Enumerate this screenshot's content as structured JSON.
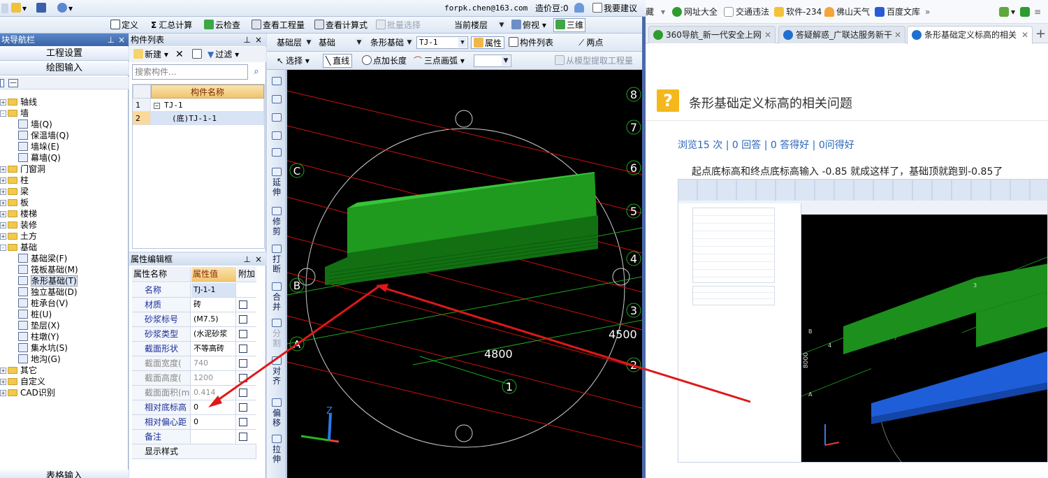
{
  "toolbar_top": {
    "email": "forpk.chen@163.com",
    "beans": "造价豆:0",
    "suggest": "我要建议"
  },
  "toolbar_main": {
    "define": "定义",
    "sum_calc": "汇总计算",
    "cloud_check": "云检查",
    "view_qty": "查看工程量",
    "view_formula": "查看计算式",
    "batch_select": "批量选择",
    "floor_select": "当前楼层",
    "top_view": "俯视",
    "three_d": "三维"
  },
  "nav": {
    "title": "块导航栏",
    "project_settings": "工程设置",
    "drawing_input": "绘图输入",
    "tree": [
      {
        "label": "轴线",
        "level": 0,
        "type": "folder",
        "expander": "+"
      },
      {
        "label": "墙",
        "level": 0,
        "type": "folder",
        "expander": "-"
      },
      {
        "label": "墙(Q)",
        "level": 1,
        "type": "leaf"
      },
      {
        "label": "保温墙(Q)",
        "level": 1,
        "type": "leaf"
      },
      {
        "label": "墙垛(E)",
        "level": 1,
        "type": "leaf"
      },
      {
        "label": "幕墙(Q)",
        "level": 1,
        "type": "leaf"
      },
      {
        "label": "门窗洞",
        "level": 0,
        "type": "folder",
        "expander": "+"
      },
      {
        "label": "柱",
        "level": 0,
        "type": "folder",
        "expander": "+"
      },
      {
        "label": "梁",
        "level": 0,
        "type": "folder",
        "expander": "+"
      },
      {
        "label": "板",
        "level": 0,
        "type": "folder",
        "expander": "+"
      },
      {
        "label": "楼梯",
        "level": 0,
        "type": "folder",
        "expander": "+"
      },
      {
        "label": "装修",
        "level": 0,
        "type": "folder",
        "expander": "+"
      },
      {
        "label": "土方",
        "level": 0,
        "type": "folder",
        "expander": "+"
      },
      {
        "label": "基础",
        "level": 0,
        "type": "folder",
        "expander": "-"
      },
      {
        "label": "基础梁(F)",
        "level": 1,
        "type": "leaf"
      },
      {
        "label": "筏板基础(M)",
        "level": 1,
        "type": "leaf"
      },
      {
        "label": "条形基础(T)",
        "level": 1,
        "type": "leaf",
        "selected": true
      },
      {
        "label": "独立基础(D)",
        "level": 1,
        "type": "leaf"
      },
      {
        "label": "桩承台(V)",
        "level": 1,
        "type": "leaf"
      },
      {
        "label": "桩(U)",
        "level": 1,
        "type": "leaf"
      },
      {
        "label": "垫层(X)",
        "level": 1,
        "type": "leaf"
      },
      {
        "label": "柱墩(Y)",
        "level": 1,
        "type": "leaf"
      },
      {
        "label": "集水坑(S)",
        "level": 1,
        "type": "leaf"
      },
      {
        "label": "地沟(G)",
        "level": 1,
        "type": "leaf"
      },
      {
        "label": "其它",
        "level": 0,
        "type": "folder",
        "expander": "+"
      },
      {
        "label": "自定义",
        "level": 0,
        "type": "folder",
        "expander": "+"
      },
      {
        "label": "CAD识别",
        "level": 0,
        "type": "folder",
        "expander": "+"
      }
    ],
    "bottom_button": "表格输入"
  },
  "component_list": {
    "title": "构件列表",
    "new_label": "新建",
    "filter_label": "过滤",
    "search_placeholder": "搜索构件...",
    "col_header": "构件名称",
    "rows": [
      {
        "num": "1",
        "name": "TJ-1"
      },
      {
        "num": "2",
        "name": "(底)TJ-1-1"
      }
    ]
  },
  "properties": {
    "title": "属性编辑框",
    "headers": [
      "属性名称",
      "属性值",
      "附加"
    ],
    "rows": [
      {
        "name": "名称",
        "value": "TJ-1-1",
        "style": "blue",
        "check": false
      },
      {
        "name": "材质",
        "value": "砖",
        "style": "blue",
        "check": true
      },
      {
        "name": "砂浆标号",
        "value": "(M7.5)",
        "style": "blue",
        "check": true
      },
      {
        "name": "砂浆类型",
        "value": "(水泥砂浆",
        "style": "blue",
        "check": true
      },
      {
        "name": "截面形状",
        "value": "不等高砖",
        "style": "blue",
        "check": true
      },
      {
        "name": "截面宽度(",
        "value": "740",
        "style": "grey",
        "check": true
      },
      {
        "name": "截面高度(",
        "value": "1200",
        "style": "grey",
        "check": true
      },
      {
        "name": "截面面积(m",
        "value": "0.414",
        "style": "grey",
        "check": true
      },
      {
        "name": "相对底标高",
        "value": "0",
        "style": "blue",
        "check": true
      },
      {
        "name": "相对偏心距",
        "value": "0",
        "style": "blue",
        "check": true
      },
      {
        "name": "备注",
        "value": "",
        "style": "blue",
        "check": true
      },
      {
        "name": "显示样式",
        "value": "",
        "style": "plain",
        "check": false
      }
    ]
  },
  "draw_bar": {
    "layer": "基础层",
    "category": "基础",
    "type": "条形基础",
    "component": "TJ-1",
    "attributes": "属性",
    "component_list": "构件列表",
    "two_points": "两点",
    "select": "选择",
    "line": "直线",
    "point_length": "点加长度",
    "three_point_arc": "三点画弧",
    "extract": "从模型提取工程量"
  },
  "vertical_tools": [
    "延伸",
    "修剪",
    "打断",
    "合并",
    "分割",
    "对齐",
    "偏移",
    "拉伸"
  ],
  "viewport": {
    "dim_4800": "4800",
    "dim_4500": "4500",
    "axis_numbers": [
      "8",
      "7",
      "6",
      "5",
      "4",
      "3",
      "2",
      "1"
    ],
    "axis_letters": [
      "C",
      "B",
      "A"
    ],
    "z_label": "Z",
    "colors": {
      "beam": "#1f9a1f",
      "beam_dark": "#127012",
      "grid_red": "#d01010",
      "grid_green": "#1fa81f",
      "arrow": "#e01818"
    }
  },
  "browser": {
    "favorites": [
      "网址大全",
      "交通违法",
      "软件-234",
      "佛山天气",
      "百度文库"
    ],
    "fav_prefix": "藏",
    "tabs": [
      {
        "label": "360导航_新一代安全上网",
        "active": false
      },
      {
        "label": "答疑解惑_广联达服务新干",
        "active": false
      },
      {
        "label": "条形基础定义标高的相关",
        "active": true
      }
    ],
    "question_title": "条形基础定义标高的相关问题",
    "stats": "浏览15 次 | 0 回答 | 0 答得好 | 0问得好",
    "body": "起点底标高和终点底标高输入 -0.85 就成这样了，基础顶就跑到-0.85了",
    "embedded_dim": "8000"
  }
}
